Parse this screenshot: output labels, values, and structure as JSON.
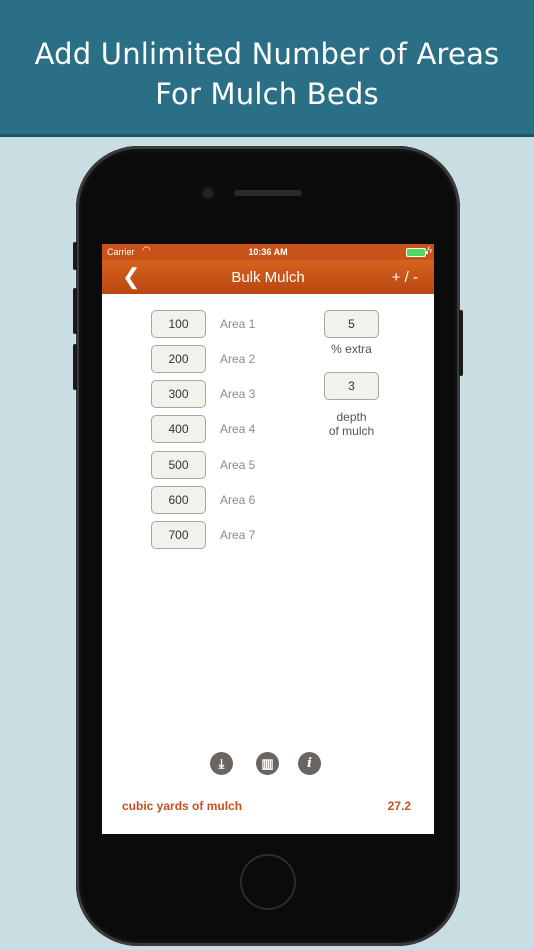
{
  "banner": {
    "line1": "Add Unlimited Number of Areas",
    "line2": "For Mulch Beds"
  },
  "status_bar": {
    "carrier": "Carrier",
    "time": "10:36 AM"
  },
  "nav": {
    "title": "Bulk Mulch",
    "back_glyph": "❮",
    "plus_minus": "+ / -"
  },
  "areas": [
    {
      "value": "100",
      "label": "Area 1"
    },
    {
      "value": "200",
      "label": "Area 2"
    },
    {
      "value": "300",
      "label": "Area 3"
    },
    {
      "value": "400",
      "label": "Area 4"
    },
    {
      "value": "500",
      "label": "Area 5"
    },
    {
      "value": "600",
      "label": "Area 6"
    },
    {
      "value": "700",
      "label": "Area 7"
    }
  ],
  "options": {
    "extra_value": "5",
    "extra_label": "% extra",
    "depth_value": "3",
    "depth_label_line1": "depth",
    "depth_label_line2": "of mulch"
  },
  "toolbar": {
    "download_icon": "download-icon",
    "trash_icon": "trash-icon",
    "info_icon": "info-icon"
  },
  "result": {
    "label": "cubic yards of mulch",
    "value": "27.2"
  },
  "colors": {
    "banner": "#2a6f86",
    "accent": "#c9501b",
    "background": "#c9dde3"
  }
}
